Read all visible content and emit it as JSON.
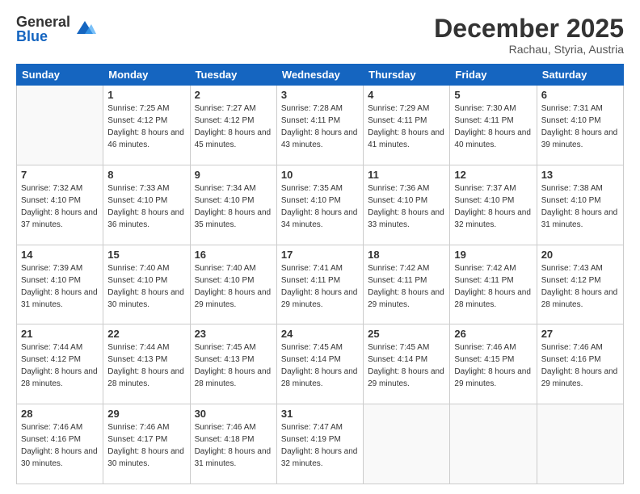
{
  "logo": {
    "general": "General",
    "blue": "Blue"
  },
  "header": {
    "month": "December 2025",
    "location": "Rachau, Styria, Austria"
  },
  "days_of_week": [
    "Sunday",
    "Monday",
    "Tuesday",
    "Wednesday",
    "Thursday",
    "Friday",
    "Saturday"
  ],
  "weeks": [
    [
      {
        "num": "",
        "sunrise": "",
        "sunset": "",
        "daylight": ""
      },
      {
        "num": "1",
        "sunrise": "Sunrise: 7:25 AM",
        "sunset": "Sunset: 4:12 PM",
        "daylight": "Daylight: 8 hours and 46 minutes."
      },
      {
        "num": "2",
        "sunrise": "Sunrise: 7:27 AM",
        "sunset": "Sunset: 4:12 PM",
        "daylight": "Daylight: 8 hours and 45 minutes."
      },
      {
        "num": "3",
        "sunrise": "Sunrise: 7:28 AM",
        "sunset": "Sunset: 4:11 PM",
        "daylight": "Daylight: 8 hours and 43 minutes."
      },
      {
        "num": "4",
        "sunrise": "Sunrise: 7:29 AM",
        "sunset": "Sunset: 4:11 PM",
        "daylight": "Daylight: 8 hours and 41 minutes."
      },
      {
        "num": "5",
        "sunrise": "Sunrise: 7:30 AM",
        "sunset": "Sunset: 4:11 PM",
        "daylight": "Daylight: 8 hours and 40 minutes."
      },
      {
        "num": "6",
        "sunrise": "Sunrise: 7:31 AM",
        "sunset": "Sunset: 4:10 PM",
        "daylight": "Daylight: 8 hours and 39 minutes."
      }
    ],
    [
      {
        "num": "7",
        "sunrise": "Sunrise: 7:32 AM",
        "sunset": "Sunset: 4:10 PM",
        "daylight": "Daylight: 8 hours and 37 minutes."
      },
      {
        "num": "8",
        "sunrise": "Sunrise: 7:33 AM",
        "sunset": "Sunset: 4:10 PM",
        "daylight": "Daylight: 8 hours and 36 minutes."
      },
      {
        "num": "9",
        "sunrise": "Sunrise: 7:34 AM",
        "sunset": "Sunset: 4:10 PM",
        "daylight": "Daylight: 8 hours and 35 minutes."
      },
      {
        "num": "10",
        "sunrise": "Sunrise: 7:35 AM",
        "sunset": "Sunset: 4:10 PM",
        "daylight": "Daylight: 8 hours and 34 minutes."
      },
      {
        "num": "11",
        "sunrise": "Sunrise: 7:36 AM",
        "sunset": "Sunset: 4:10 PM",
        "daylight": "Daylight: 8 hours and 33 minutes."
      },
      {
        "num": "12",
        "sunrise": "Sunrise: 7:37 AM",
        "sunset": "Sunset: 4:10 PM",
        "daylight": "Daylight: 8 hours and 32 minutes."
      },
      {
        "num": "13",
        "sunrise": "Sunrise: 7:38 AM",
        "sunset": "Sunset: 4:10 PM",
        "daylight": "Daylight: 8 hours and 31 minutes."
      }
    ],
    [
      {
        "num": "14",
        "sunrise": "Sunrise: 7:39 AM",
        "sunset": "Sunset: 4:10 PM",
        "daylight": "Daylight: 8 hours and 31 minutes."
      },
      {
        "num": "15",
        "sunrise": "Sunrise: 7:40 AM",
        "sunset": "Sunset: 4:10 PM",
        "daylight": "Daylight: 8 hours and 30 minutes."
      },
      {
        "num": "16",
        "sunrise": "Sunrise: 7:40 AM",
        "sunset": "Sunset: 4:10 PM",
        "daylight": "Daylight: 8 hours and 29 minutes."
      },
      {
        "num": "17",
        "sunrise": "Sunrise: 7:41 AM",
        "sunset": "Sunset: 4:11 PM",
        "daylight": "Daylight: 8 hours and 29 minutes."
      },
      {
        "num": "18",
        "sunrise": "Sunrise: 7:42 AM",
        "sunset": "Sunset: 4:11 PM",
        "daylight": "Daylight: 8 hours and 29 minutes."
      },
      {
        "num": "19",
        "sunrise": "Sunrise: 7:42 AM",
        "sunset": "Sunset: 4:11 PM",
        "daylight": "Daylight: 8 hours and 28 minutes."
      },
      {
        "num": "20",
        "sunrise": "Sunrise: 7:43 AM",
        "sunset": "Sunset: 4:12 PM",
        "daylight": "Daylight: 8 hours and 28 minutes."
      }
    ],
    [
      {
        "num": "21",
        "sunrise": "Sunrise: 7:44 AM",
        "sunset": "Sunset: 4:12 PM",
        "daylight": "Daylight: 8 hours and 28 minutes."
      },
      {
        "num": "22",
        "sunrise": "Sunrise: 7:44 AM",
        "sunset": "Sunset: 4:13 PM",
        "daylight": "Daylight: 8 hours and 28 minutes."
      },
      {
        "num": "23",
        "sunrise": "Sunrise: 7:45 AM",
        "sunset": "Sunset: 4:13 PM",
        "daylight": "Daylight: 8 hours and 28 minutes."
      },
      {
        "num": "24",
        "sunrise": "Sunrise: 7:45 AM",
        "sunset": "Sunset: 4:14 PM",
        "daylight": "Daylight: 8 hours and 28 minutes."
      },
      {
        "num": "25",
        "sunrise": "Sunrise: 7:45 AM",
        "sunset": "Sunset: 4:14 PM",
        "daylight": "Daylight: 8 hours and 29 minutes."
      },
      {
        "num": "26",
        "sunrise": "Sunrise: 7:46 AM",
        "sunset": "Sunset: 4:15 PM",
        "daylight": "Daylight: 8 hours and 29 minutes."
      },
      {
        "num": "27",
        "sunrise": "Sunrise: 7:46 AM",
        "sunset": "Sunset: 4:16 PM",
        "daylight": "Daylight: 8 hours and 29 minutes."
      }
    ],
    [
      {
        "num": "28",
        "sunrise": "Sunrise: 7:46 AM",
        "sunset": "Sunset: 4:16 PM",
        "daylight": "Daylight: 8 hours and 30 minutes."
      },
      {
        "num": "29",
        "sunrise": "Sunrise: 7:46 AM",
        "sunset": "Sunset: 4:17 PM",
        "daylight": "Daylight: 8 hours and 30 minutes."
      },
      {
        "num": "30",
        "sunrise": "Sunrise: 7:46 AM",
        "sunset": "Sunset: 4:18 PM",
        "daylight": "Daylight: 8 hours and 31 minutes."
      },
      {
        "num": "31",
        "sunrise": "Sunrise: 7:47 AM",
        "sunset": "Sunset: 4:19 PM",
        "daylight": "Daylight: 8 hours and 32 minutes."
      },
      {
        "num": "",
        "sunrise": "",
        "sunset": "",
        "daylight": ""
      },
      {
        "num": "",
        "sunrise": "",
        "sunset": "",
        "daylight": ""
      },
      {
        "num": "",
        "sunrise": "",
        "sunset": "",
        "daylight": ""
      }
    ]
  ]
}
